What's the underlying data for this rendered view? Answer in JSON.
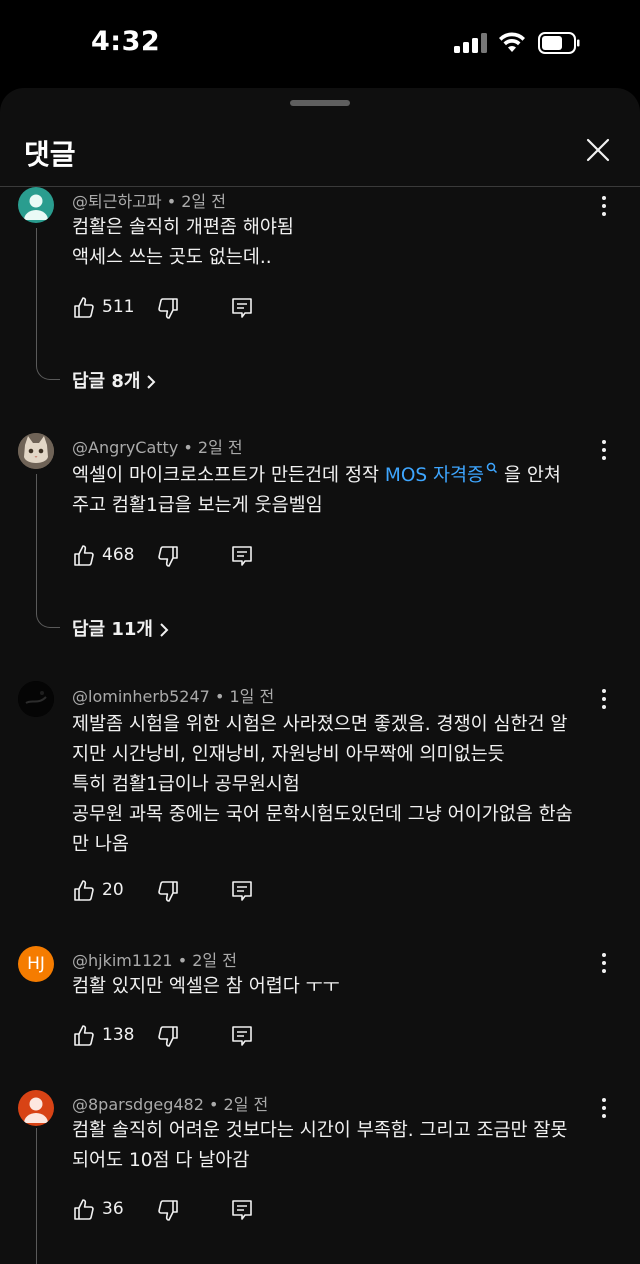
{
  "status_bar": {
    "time": "4:32"
  },
  "sheet": {
    "title": "댓글"
  },
  "comments": [
    {
      "author": "@퇴근하고파",
      "age": "2일 전",
      "lines": [
        "컴활은 솔직히 개편좀 해야됨",
        "액세스 쓰는 곳도 없는데.."
      ],
      "likes": "511",
      "replies": "답글 8개",
      "avatar_icon": "default-avatar-icon",
      "avatar_color": "#2a9d8f"
    },
    {
      "author": "@AngryCatty",
      "age": "2일 전",
      "text_before_link": "엑셀이 마이크로소프트가 만든건데 정작 ",
      "link_text": "MOS 자격증",
      "text_after_link": " 을 안쳐",
      "line2": "주고 컴활1급을 보는게 웃음벨임",
      "likes": "468",
      "replies": "답글 11개",
      "avatar_icon": "cat-photo-avatar"
    },
    {
      "author": "@lominherb5247",
      "age": "1일 전",
      "lines": [
        "제발좀 시험을 위한 시험은 사라졌으면 좋겠음. 경쟁이 심한건 알",
        "지만 시간낭비, 인재낭비, 자원낭비 아무짝에 의미없는듯",
        "특히 컴활1급이나  공무원시험",
        "공무원 과목 중에는 국어 문학시험도있던데 그냥 어이가없음 한숨",
        "만 나옴"
      ],
      "likes": "20",
      "avatar_icon": "dark-photo-avatar"
    },
    {
      "author": "@hjkim1121",
      "age": "2일 전",
      "lines": [
        "컴활 있지만 엑셀은 참 어렵다 ㅜㅜ"
      ],
      "likes": "138",
      "avatar_initials": "HJ",
      "avatar_color": "#f57c00"
    },
    {
      "author": "@8parsdgeg482",
      "age": "2일 전",
      "lines": [
        "컴활 솔직히 어려운 것보다는 시간이 부족함. 그리고 조금만 잘못",
        "되어도 10점 다 날아감"
      ],
      "likes": "36",
      "avatar_icon": "default-avatar-icon",
      "avatar_color": "#d84315"
    }
  ]
}
